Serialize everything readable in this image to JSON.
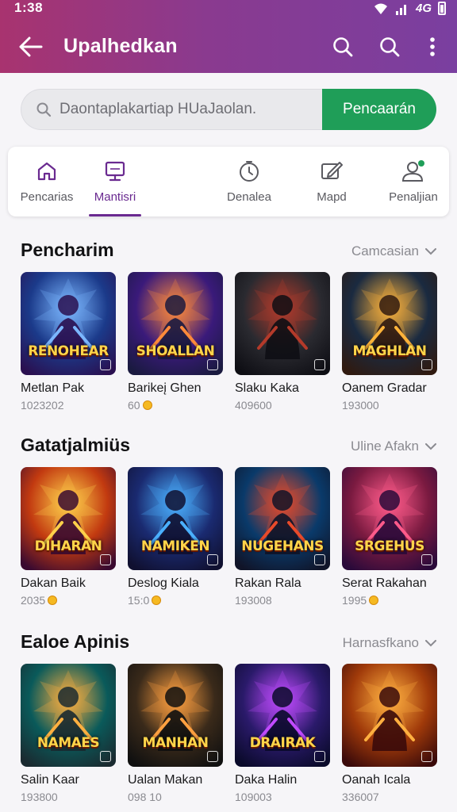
{
  "status": {
    "time": "1:38",
    "network": "4G"
  },
  "header": {
    "title": "Upalhedkan"
  },
  "search": {
    "placeholder": "Daontaplakartiap HUaJaolan.",
    "button_label": "Pencaarán"
  },
  "tabs": [
    {
      "label": "Pencarias",
      "icon": "home-icon"
    },
    {
      "label": "Mantisri",
      "icon": "monitor-icon",
      "active": true
    },
    {
      "label": "Denalea",
      "icon": "timer-icon"
    },
    {
      "label": "Mapd",
      "icon": "edit-icon"
    },
    {
      "label": "Penaljian",
      "icon": "profile-icon"
    }
  ],
  "sections": [
    {
      "title": "Pencharim",
      "more": "Camcasian",
      "games": [
        {
          "name": "Metlan Pak",
          "meta": "1023202",
          "logo": "RENOHEAR",
          "coin": false
        },
        {
          "name": "Barikeį Ghen",
          "meta": "60",
          "logo": "SHOALLAN",
          "coin": true
        },
        {
          "name": "Slaku Kaka",
          "meta": "409600",
          "logo": "",
          "coin": false
        },
        {
          "name": "Oanem Gradar",
          "meta": "193000",
          "logo": "MAGHLAN",
          "coin": false
        }
      ]
    },
    {
      "title": "Gatatjalmiüs",
      "more": "Uline Afakn",
      "games": [
        {
          "name": "Dakan Baik",
          "meta": "2035",
          "logo": "DIHARAN",
          "coin": true
        },
        {
          "name": "Deslog Kiala",
          "meta": "15:0",
          "logo": "NAMIKEN",
          "coin": true
        },
        {
          "name": "Rakan Rala",
          "meta": "193008",
          "logo": "NUGEHANS",
          "coin": false
        },
        {
          "name": "Serat Rakahan",
          "meta": "1995",
          "logo": "SRGEHUS",
          "coin": true
        }
      ]
    },
    {
      "title": "Ealoe Apinis",
      "more": "Harnasfkano",
      "games": [
        {
          "name": "Salin Kaar",
          "meta": "193800",
          "logo": "NAMAES",
          "coin": false
        },
        {
          "name": "Ualan Makan",
          "meta": "098 10",
          "logo": "MANHAN",
          "coin": false
        },
        {
          "name": "Daka Halin",
          "meta": "109003",
          "logo": "DRAIRAK",
          "coin": false
        },
        {
          "name": "Oanah Icala",
          "meta": "336007",
          "logo": "",
          "coin": false
        }
      ]
    }
  ],
  "colors": {
    "appbar_start": "#a8336f",
    "appbar_end": "#7a3fa0",
    "accent": "#6a2a90",
    "search_button": "#1f9e58"
  }
}
